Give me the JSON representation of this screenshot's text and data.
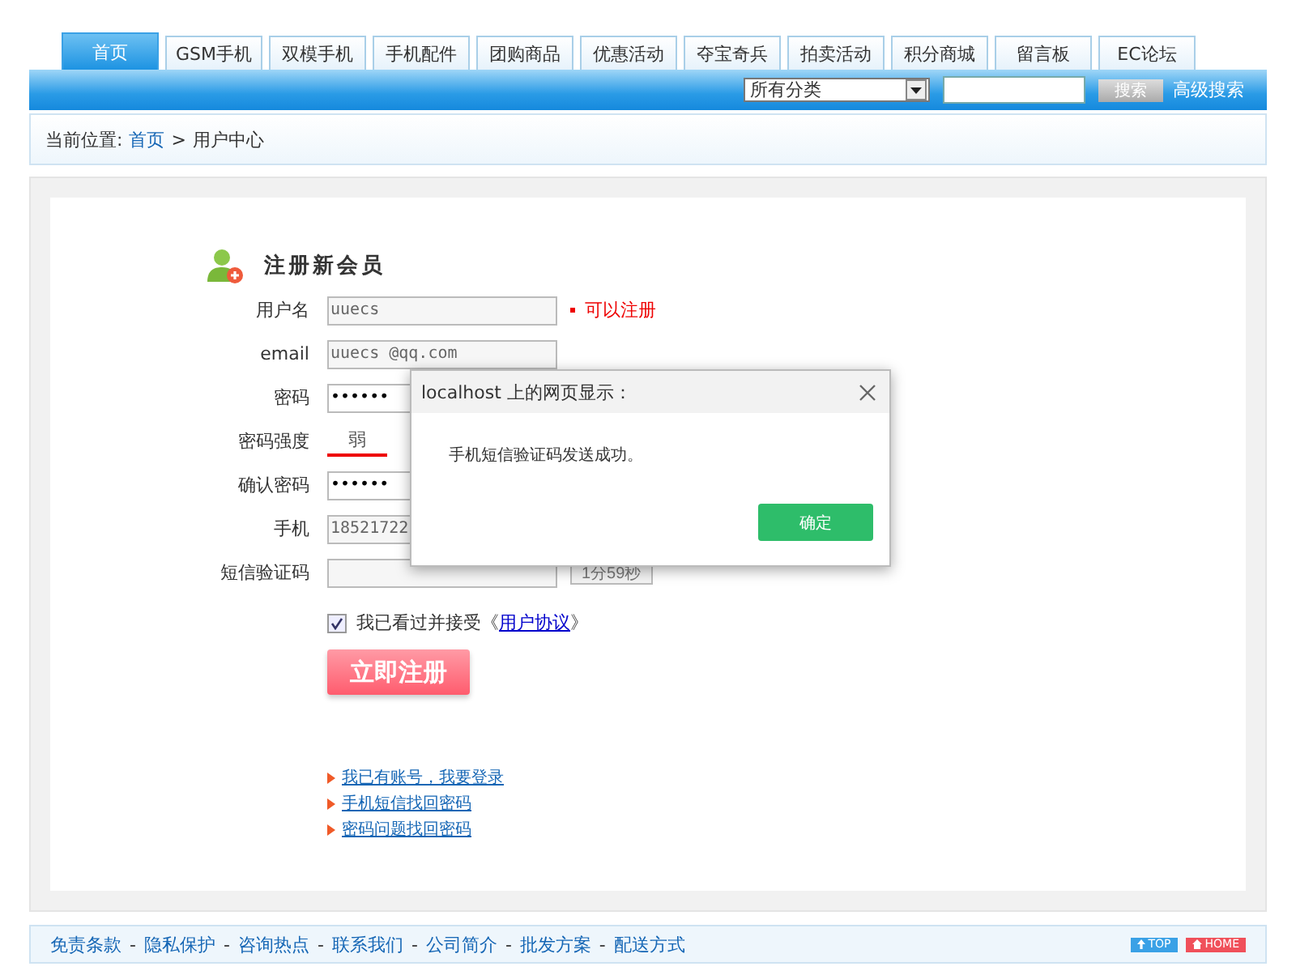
{
  "nav": {
    "tabs": [
      {
        "label": "首页",
        "selected": true
      },
      {
        "label": "GSM手机",
        "selected": false
      },
      {
        "label": "双模手机",
        "selected": false
      },
      {
        "label": "手机配件",
        "selected": false
      },
      {
        "label": "团购商品",
        "selected": false
      },
      {
        "label": "优惠活动",
        "selected": false
      },
      {
        "label": "夺宝奇兵",
        "selected": false
      },
      {
        "label": "拍卖活动",
        "selected": false
      },
      {
        "label": "积分商城",
        "selected": false
      },
      {
        "label": "留言板",
        "selected": false
      },
      {
        "label": "EC论坛",
        "selected": false
      }
    ],
    "category": "所有分类",
    "search_button": "搜索",
    "advanced_search": "高级搜索"
  },
  "breadcrumb": {
    "prefix": "当前位置:",
    "home": "首页",
    "separator": ">",
    "current": "用户中心"
  },
  "form": {
    "title": "注册新会员",
    "rows": [
      {
        "kind": "text",
        "label": "用户名",
        "value": "uuecs",
        "status": "可以注册"
      },
      {
        "kind": "text",
        "label": "email",
        "value": "uuecs @qq.com"
      },
      {
        "kind": "password",
        "label": "密码",
        "value": "••••••"
      },
      {
        "kind": "strength",
        "label": "密码强度",
        "value": "弱",
        "level": 0.33
      },
      {
        "kind": "password",
        "label": "确认密码",
        "value": "••••••"
      },
      {
        "kind": "text",
        "label": "手机",
        "value": "18521722"
      },
      {
        "kind": "code",
        "label": "短信验证码",
        "button": "1分59秒"
      }
    ],
    "agree": {
      "checked": true,
      "text": "我已看过并接受《",
      "link": "用户协议",
      "suffix": "》"
    },
    "submit": "立即注册",
    "links": [
      "我已有账号，我要登录",
      "手机短信找回密码",
      "密码问题找回密码"
    ]
  },
  "dialog": {
    "title": "localhost 上的网页显示：",
    "message": "手机短信验证码发送成功。",
    "ok": "确定"
  },
  "footer": {
    "links": [
      "免责条款",
      "隐私保护",
      "咨询热点",
      "联系我们",
      "公司简介",
      "批发方案",
      "配送方式"
    ],
    "separator": "-",
    "badges": [
      {
        "kind": "top",
        "label": "TOP"
      },
      {
        "kind": "home",
        "label": "HOME"
      }
    ]
  }
}
